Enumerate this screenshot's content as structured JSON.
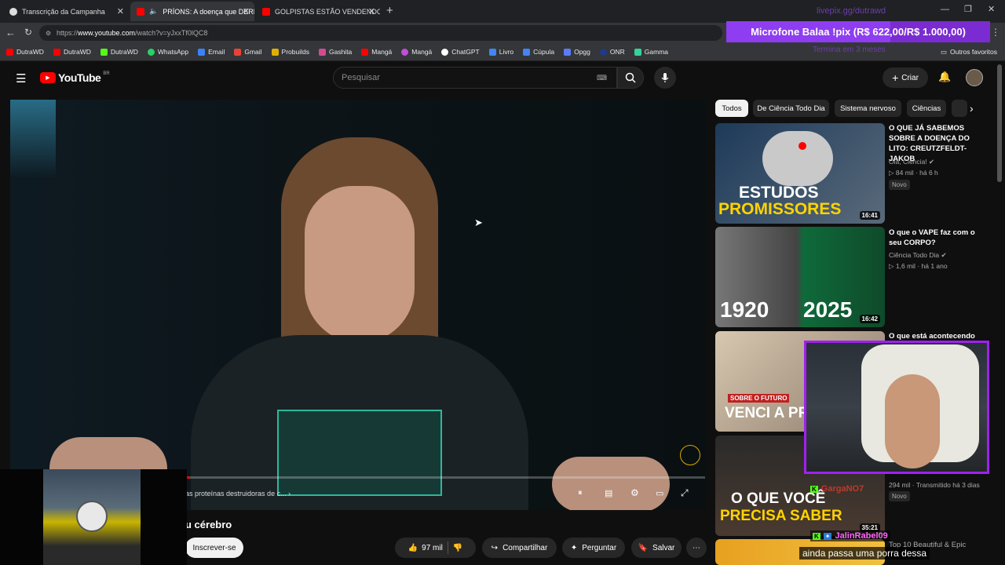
{
  "browser": {
    "tabs": [
      {
        "title": "Transcrição da Campanha",
        "active": false
      },
      {
        "title": "PRÍONS: A doença que DERR",
        "active": true
      },
      {
        "title": "GOLPISTAS ESTÃO VENDENDO FI",
        "active": false
      }
    ],
    "url_prefix": "https://",
    "url_domain": "www.youtube.com",
    "url_path": "/watch?v=yJxxTf0lQC8",
    "bookmarks": [
      "DutraWD",
      "DutraWD",
      "DutraWD",
      "WhatsApp",
      "Email",
      "Gmail",
      "Probuilds",
      "Gashita",
      "Mangá",
      "Mangá",
      "ChatGPT",
      "Livro",
      "Cúpula",
      "Opgg",
      "ONR",
      "Gamma"
    ],
    "other_favorites": "Outros favoritos"
  },
  "overlay": {
    "livepix": "livepix.gg/dutrawd",
    "donation_goal": "Microfone Balaa !pix (R$ 622,00/R$ 1.000,00)",
    "donation_progress": 0.622,
    "timer": "Termina em 3 meses"
  },
  "youtube": {
    "logo": "YouTube",
    "region": "BR",
    "search_placeholder": "Pesquisar",
    "create_label": "Criar"
  },
  "video": {
    "chapter": "as proteínas destruidoras de c...",
    "title_fragment": "u cérebro",
    "subscribe": "Inscrever-se",
    "likes": "97 mil",
    "share": "Compartilhar",
    "ask": "Perguntar",
    "save": "Salvar",
    "progress": 0.003
  },
  "chips": [
    "Todos",
    "De Ciência Todo Dia",
    "Sistema nervoso",
    "Ciências"
  ],
  "recommendations": [
    {
      "title": "O QUE JÁ SABEMOS SOBRE A DOENÇA DO LITO: CREUTZFELDT-JAKOB",
      "channel": "Olá, Ciência!",
      "views": "84 mil",
      "age": "há 6 h",
      "badge": "Novo",
      "duration": "16:41",
      "thumb_text_1": "ESTUDOS",
      "thumb_text_2": "PROMISSORES"
    },
    {
      "title": "O que o VAPE faz com o seu CORPO?",
      "channel": "Ciência Todo Dia",
      "views": "1,6 mil",
      "age": "há 1 ano",
      "duration": "16:42",
      "thumb_text_1": "1920",
      "thumb_text_2": "2025"
    },
    {
      "title": "O que está acontecendo",
      "thumb_text_1": "SOBRE O FUTURO",
      "thumb_text_2": "VENCI A PRIME"
    },
    {
      "views": "294 mil",
      "age": "Transmitido há 3 dias",
      "badge": "Novo",
      "duration": "35:21",
      "thumb_text_1": "O QUE VOCÊ",
      "thumb_text_2": "PRECISA SABER"
    },
    {
      "title": "Top 10 Beautiful & Epic"
    }
  ],
  "chat": [
    {
      "user": "GargaNO7",
      "message": ""
    },
    {
      "user": "JalinRabel09",
      "message": "ainda passa uma porra dessa"
    }
  ]
}
